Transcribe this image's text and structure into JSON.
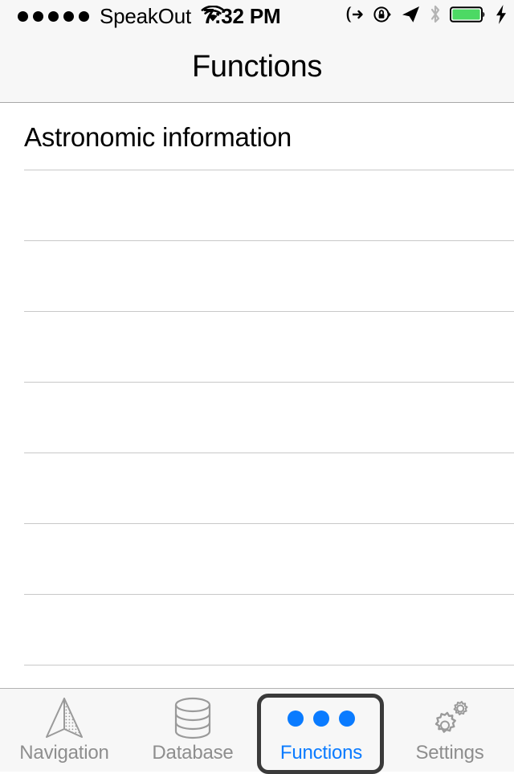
{
  "status_bar": {
    "signal_dots": 5,
    "signal_dots_filled": 5,
    "carrier": "SpeakOut",
    "wifi_icon": "wifi-icon",
    "time": "7:32 PM",
    "right_icons": [
      {
        "name": "call-forwarding-icon",
        "state": "active"
      },
      {
        "name": "rotation-lock-icon",
        "state": "active"
      },
      {
        "name": "location-arrow-icon",
        "state": "active"
      },
      {
        "name": "bluetooth-icon",
        "state": "inactive"
      },
      {
        "name": "battery-icon",
        "state": "charging",
        "fill_color": "#4cd964"
      },
      {
        "name": "charging-bolt-icon",
        "state": "active"
      }
    ]
  },
  "nav_bar": {
    "title": "Functions"
  },
  "content": {
    "rows": [
      {
        "label": "Astronomic information"
      },
      {
        "label": ""
      },
      {
        "label": ""
      },
      {
        "label": ""
      },
      {
        "label": ""
      },
      {
        "label": ""
      },
      {
        "label": ""
      },
      {
        "label": ""
      }
    ]
  },
  "tab_bar": {
    "selected_index": 2,
    "accent_color": "#0a7bff",
    "inactive_color": "#8e8e8e",
    "items": [
      {
        "label": "Navigation",
        "icon": "navigation-arrow-icon",
        "selected": false
      },
      {
        "label": "Database",
        "icon": "database-cylinder-icon",
        "selected": false
      },
      {
        "label": "Functions",
        "icon": "three-dots-icon",
        "selected": true
      },
      {
        "label": "Settings",
        "icon": "gears-icon",
        "selected": false
      }
    ]
  }
}
